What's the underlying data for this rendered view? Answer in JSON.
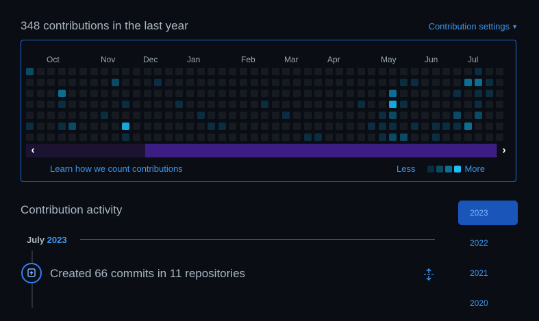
{
  "header": {
    "contributions_title": "348 contributions in the last year",
    "settings_label": "Contribution settings"
  },
  "graph": {
    "months": [
      "Oct",
      "Nov",
      "Dec",
      "Jan",
      "Feb",
      "Mar",
      "Apr",
      "May",
      "Jun",
      "Jul"
    ],
    "level_colors": [
      "#161b22",
      "#0b2d40",
      "#0a4a63",
      "#0d6e94",
      "#15a6de",
      "#1dc0f5"
    ],
    "weeks": [
      [
        2,
        0,
        0,
        0,
        0,
        1,
        0
      ],
      [
        0,
        0,
        0,
        0,
        0,
        0,
        0
      ],
      [
        0,
        0,
        0,
        0,
        0,
        0,
        0
      ],
      [
        0,
        0,
        3,
        1,
        0,
        1,
        0
      ],
      [
        0,
        0,
        0,
        0,
        0,
        2,
        0
      ],
      [
        0,
        0,
        0,
        0,
        0,
        0,
        0
      ],
      [
        0,
        0,
        0,
        0,
        0,
        0,
        0
      ],
      [
        0,
        0,
        0,
        0,
        1,
        0,
        0
      ],
      [
        0,
        2,
        0,
        0,
        0,
        0,
        0
      ],
      [
        0,
        0,
        0,
        1,
        0,
        4,
        1
      ],
      [
        0,
        0,
        0,
        0,
        0,
        0,
        0
      ],
      [
        0,
        0,
        0,
        0,
        0,
        0,
        0
      ],
      [
        0,
        1,
        0,
        0,
        0,
        0,
        0
      ],
      [
        0,
        0,
        0,
        0,
        0,
        0,
        0
      ],
      [
        0,
        0,
        0,
        1,
        0,
        0,
        0
      ],
      [
        0,
        0,
        0,
        0,
        0,
        0,
        0
      ],
      [
        0,
        0,
        0,
        0,
        1,
        0,
        0
      ],
      [
        0,
        0,
        0,
        0,
        0,
        1,
        0
      ],
      [
        0,
        0,
        0,
        0,
        0,
        1,
        0
      ],
      [
        0,
        0,
        0,
        0,
        0,
        0,
        0
      ],
      [
        0,
        0,
        0,
        0,
        0,
        0,
        0
      ],
      [
        0,
        0,
        0,
        0,
        0,
        0,
        0
      ],
      [
        0,
        0,
        0,
        1,
        0,
        0,
        0
      ],
      [
        0,
        0,
        0,
        0,
        0,
        0,
        0
      ],
      [
        0,
        0,
        0,
        0,
        1,
        0,
        0
      ],
      [
        0,
        0,
        0,
        0,
        0,
        0,
        0
      ],
      [
        0,
        0,
        0,
        0,
        0,
        0,
        1
      ],
      [
        0,
        0,
        0,
        0,
        0,
        0,
        1
      ],
      [
        0,
        0,
        0,
        0,
        0,
        0,
        0
      ],
      [
        0,
        0,
        0,
        0,
        0,
        0,
        0
      ],
      [
        0,
        0,
        0,
        0,
        0,
        0,
        0
      ],
      [
        0,
        0,
        0,
        1,
        0,
        0,
        0
      ],
      [
        0,
        0,
        0,
        0,
        0,
        1,
        0
      ],
      [
        0,
        0,
        0,
        0,
        1,
        1,
        1
      ],
      [
        0,
        0,
        3,
        4,
        2,
        1,
        2
      ],
      [
        0,
        1,
        0,
        1,
        0,
        0,
        2
      ],
      [
        0,
        1,
        0,
        0,
        0,
        1,
        0
      ],
      [
        0,
        0,
        0,
        0,
        0,
        0,
        0
      ],
      [
        0,
        0,
        0,
        0,
        0,
        1,
        1
      ],
      [
        0,
        0,
        0,
        0,
        0,
        1,
        0
      ],
      [
        0,
        0,
        1,
        0,
        2,
        1,
        0
      ],
      [
        0,
        3,
        0,
        0,
        0,
        3,
        0
      ],
      [
        1,
        3,
        1,
        1,
        2,
        0,
        0
      ],
      [
        0,
        1,
        1,
        0,
        0,
        0,
        0
      ],
      [
        0,
        0,
        0,
        0,
        0,
        0,
        0
      ]
    ],
    "learn_link": "Learn how we count contributions",
    "legend_less": "Less",
    "legend_more": "More",
    "scroll_left": "‹",
    "scroll_right": "›"
  },
  "activity": {
    "title": "Contribution activity",
    "month_label": "July",
    "month_year": "2023",
    "item_text": "Created 66 commits in 11 repositories",
    "item_icon": "repo-push-icon"
  },
  "years": [
    "2023",
    "2022",
    "2021",
    "2020"
  ],
  "active_year": "2023"
}
